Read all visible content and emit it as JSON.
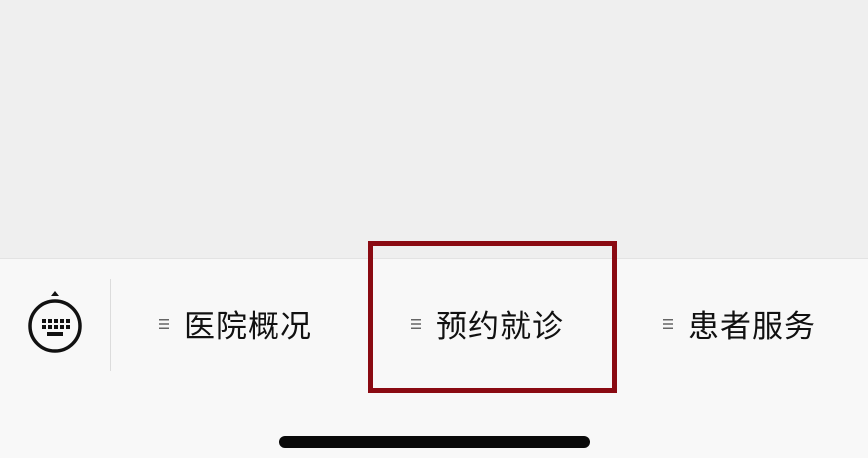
{
  "menu": {
    "items": [
      {
        "label": "医院概况",
        "icon": "menu-lines-icon"
      },
      {
        "label": "预约就诊",
        "icon": "menu-lines-icon"
      },
      {
        "label": "患者服务",
        "icon": "menu-lines-icon"
      }
    ],
    "keyboard_icon": "keyboard-toggle-icon"
  },
  "colors": {
    "highlight": "#8a0a12",
    "background_top": "#efefef",
    "bar_background": "#f8f8f8",
    "text": "#111111"
  }
}
